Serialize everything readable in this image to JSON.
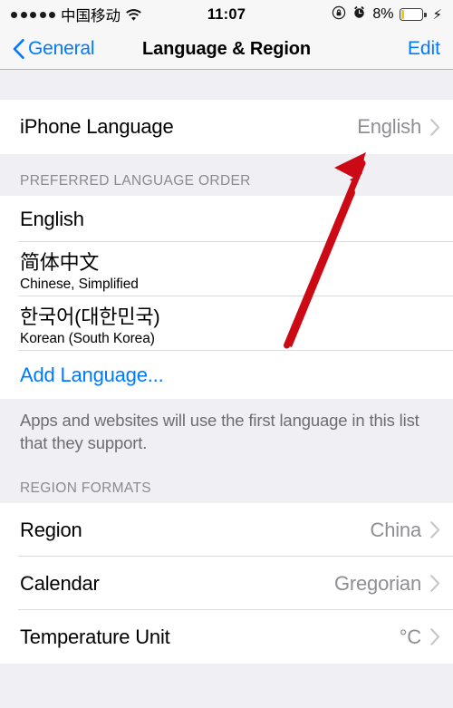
{
  "status_bar": {
    "signal_dots": 5,
    "carrier": "中国移动",
    "wifi_icon": "wifi-icon",
    "time": "11:07",
    "rotation_lock_icon": "rotation-lock-icon",
    "alarm_icon": "alarm-clock-icon",
    "battery_percent": "8%",
    "battery_fill_color": "#f5c518",
    "charging_icon": "lightning-bolt-icon"
  },
  "nav": {
    "back_label": "General",
    "back_icon": "chevron-left-icon",
    "title": "Language & Region",
    "edit_label": "Edit",
    "tint_color": "#007aff"
  },
  "iphone_language": {
    "title": "iPhone Language",
    "value": "English",
    "disclosure_icon": "chevron-right-icon"
  },
  "preferred_language_order": {
    "header": "PREFERRED LANGUAGE ORDER",
    "items": [
      {
        "title": "English",
        "subtitle": ""
      },
      {
        "title": "简体中文",
        "subtitle": "Chinese, Simplified"
      },
      {
        "title": "한국어(대한민국)",
        "subtitle": "Korean (South Korea)"
      }
    ],
    "add_language_label": "Add Language...",
    "footer": "Apps and websites will use the first language in this list that they support."
  },
  "region_formats": {
    "header": "REGION FORMATS",
    "rows": [
      {
        "title": "Region",
        "value": "China",
        "disclosure_icon": "chevron-right-icon"
      },
      {
        "title": "Calendar",
        "value": "Gregorian",
        "disclosure_icon": "chevron-right-icon"
      },
      {
        "title": "Temperature Unit",
        "value": "°C",
        "disclosure_icon": "chevron-right-icon"
      }
    ]
  },
  "annotation": {
    "arrow_icon": "red-arrow-annotation",
    "color": "#cc0a16",
    "points_to": "English"
  }
}
